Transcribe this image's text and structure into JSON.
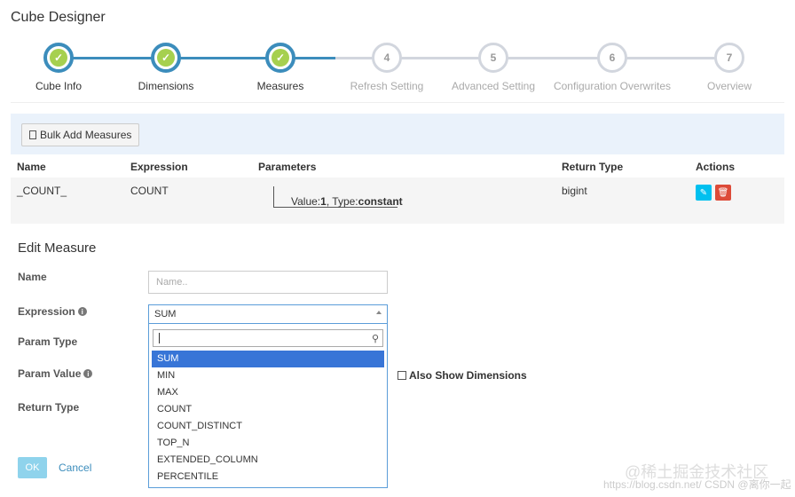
{
  "page_title": "Cube Designer",
  "wizard": {
    "steps": [
      {
        "label": "Cube Info",
        "status": "done",
        "mark": "✓"
      },
      {
        "label": "Dimensions",
        "status": "done",
        "mark": "✓"
      },
      {
        "label": "Measures",
        "status": "done",
        "mark": "✓"
      },
      {
        "label": "Refresh Setting",
        "status": "todo",
        "mark": "4"
      },
      {
        "label": "Advanced Setting",
        "status": "todo",
        "mark": "5"
      },
      {
        "label": "Configuration Overwrites",
        "status": "todo",
        "mark": "6"
      },
      {
        "label": "Overview",
        "status": "todo",
        "mark": "7"
      }
    ],
    "colors": {
      "done": "#3c8dbc",
      "check": "#a6d04f",
      "todo": "#d2d6de"
    }
  },
  "toolbar": {
    "bulk_add_label": "Bulk Add Measures"
  },
  "measures_table": {
    "headers": {
      "name": "Name",
      "expression": "Expression",
      "parameters": "Parameters",
      "return_type": "Return Type",
      "actions": "Actions"
    },
    "rows": [
      {
        "name": "_COUNT_",
        "expression": "COUNT",
        "param_value_label": "Value:",
        "param_value": "1",
        "param_type_label": ", Type:",
        "param_type": "constant",
        "return_type": "bigint"
      }
    ]
  },
  "edit_measure": {
    "title": "Edit Measure",
    "labels": {
      "name": "Name",
      "expression": "Expression",
      "param_type": "Param Type",
      "param_value": "Param Value",
      "return_type": "Return Type"
    },
    "name_placeholder": "Name..",
    "expression_selected": "SUM",
    "expression_options": [
      "SUM",
      "MIN",
      "MAX",
      "COUNT",
      "COUNT_DISTINCT",
      "TOP_N",
      "EXTENDED_COLUMN",
      "PERCENTILE"
    ],
    "also_show_dimensions": "Also Show Dimensions",
    "ok_label": "OK",
    "cancel_label": "Cancel"
  },
  "watermark": {
    "line1": "@稀土掘金技术社区",
    "line2": "https://blog.csdn.net/  CSDN @离你一起"
  }
}
